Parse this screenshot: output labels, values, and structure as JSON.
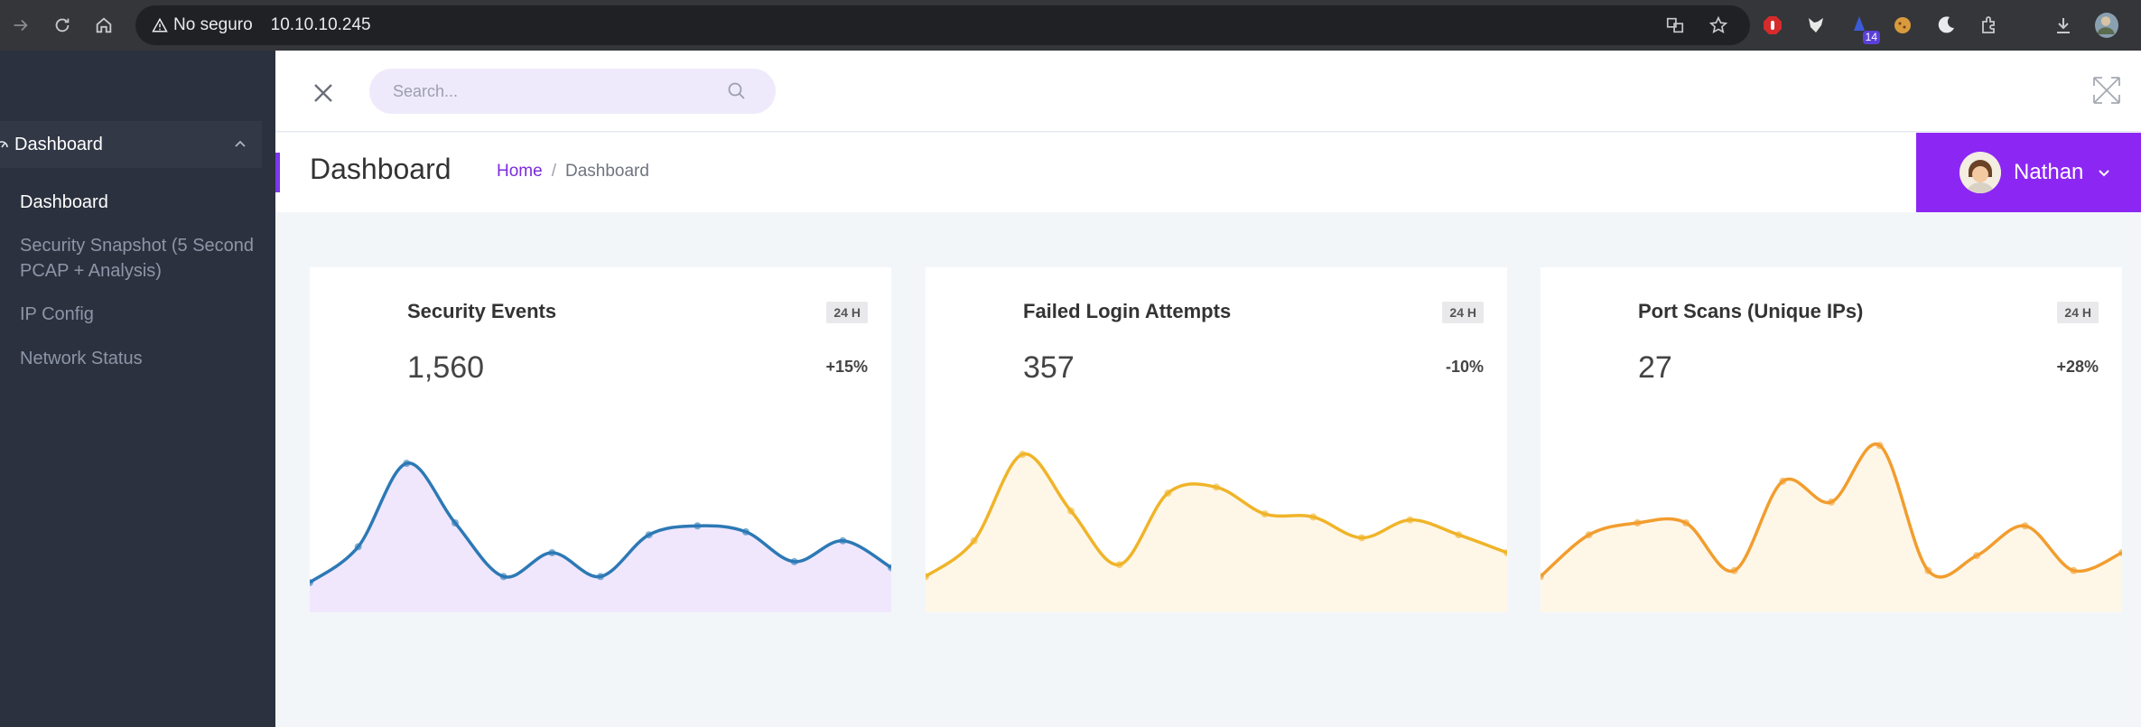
{
  "browser": {
    "security_label": "No seguro",
    "url": "10.10.10.245",
    "extension_badge": "14"
  },
  "sidebar": {
    "group_label": "Dashboard",
    "items": [
      {
        "label": "Dashboard",
        "active": true
      },
      {
        "label": "Security Snapshot (5 Second PCAP + Analysis)",
        "active": false
      },
      {
        "label": "IP Config",
        "active": false
      },
      {
        "label": "Network Status",
        "active": false
      }
    ]
  },
  "topbar": {
    "search_placeholder": "Search..."
  },
  "page": {
    "title": "Dashboard",
    "breadcrumb": {
      "home": "Home",
      "separator": "/",
      "current": "Dashboard"
    },
    "user_name": "Nathan"
  },
  "colors": {
    "accent": "#8c27f3",
    "sidebar_bg": "#2b313e",
    "series1": "#2c79b5",
    "series2": "#f0b429",
    "series3": "#f29d2e"
  },
  "cards": [
    {
      "title": "Security Events",
      "badge": "24 H",
      "value": "1,560",
      "change": "+15%",
      "line_color": "#2c79b5",
      "fill_color": "#f0e7fd",
      "series": [
        10,
        22,
        50,
        30,
        12,
        20,
        12,
        26,
        29,
        27,
        17,
        24,
        15
      ]
    },
    {
      "title": "Failed Login Attempts",
      "badge": "24 H",
      "value": "357",
      "change": "-10%",
      "line_color": "#f0b429",
      "fill_color": "#fef7e8",
      "series": [
        12,
        24,
        53,
        34,
        16,
        40,
        42,
        33,
        32,
        25,
        31,
        26,
        20
      ]
    },
    {
      "title": "Port Scans (Unique IPs)",
      "badge": "24 H",
      "value": "27",
      "change": "+28%",
      "line_color": "#f29d2e",
      "fill_color": "#fef7e8",
      "series": [
        12,
        26,
        30,
        30,
        14,
        44,
        37,
        56,
        14,
        19,
        29,
        14,
        20
      ]
    }
  ]
}
